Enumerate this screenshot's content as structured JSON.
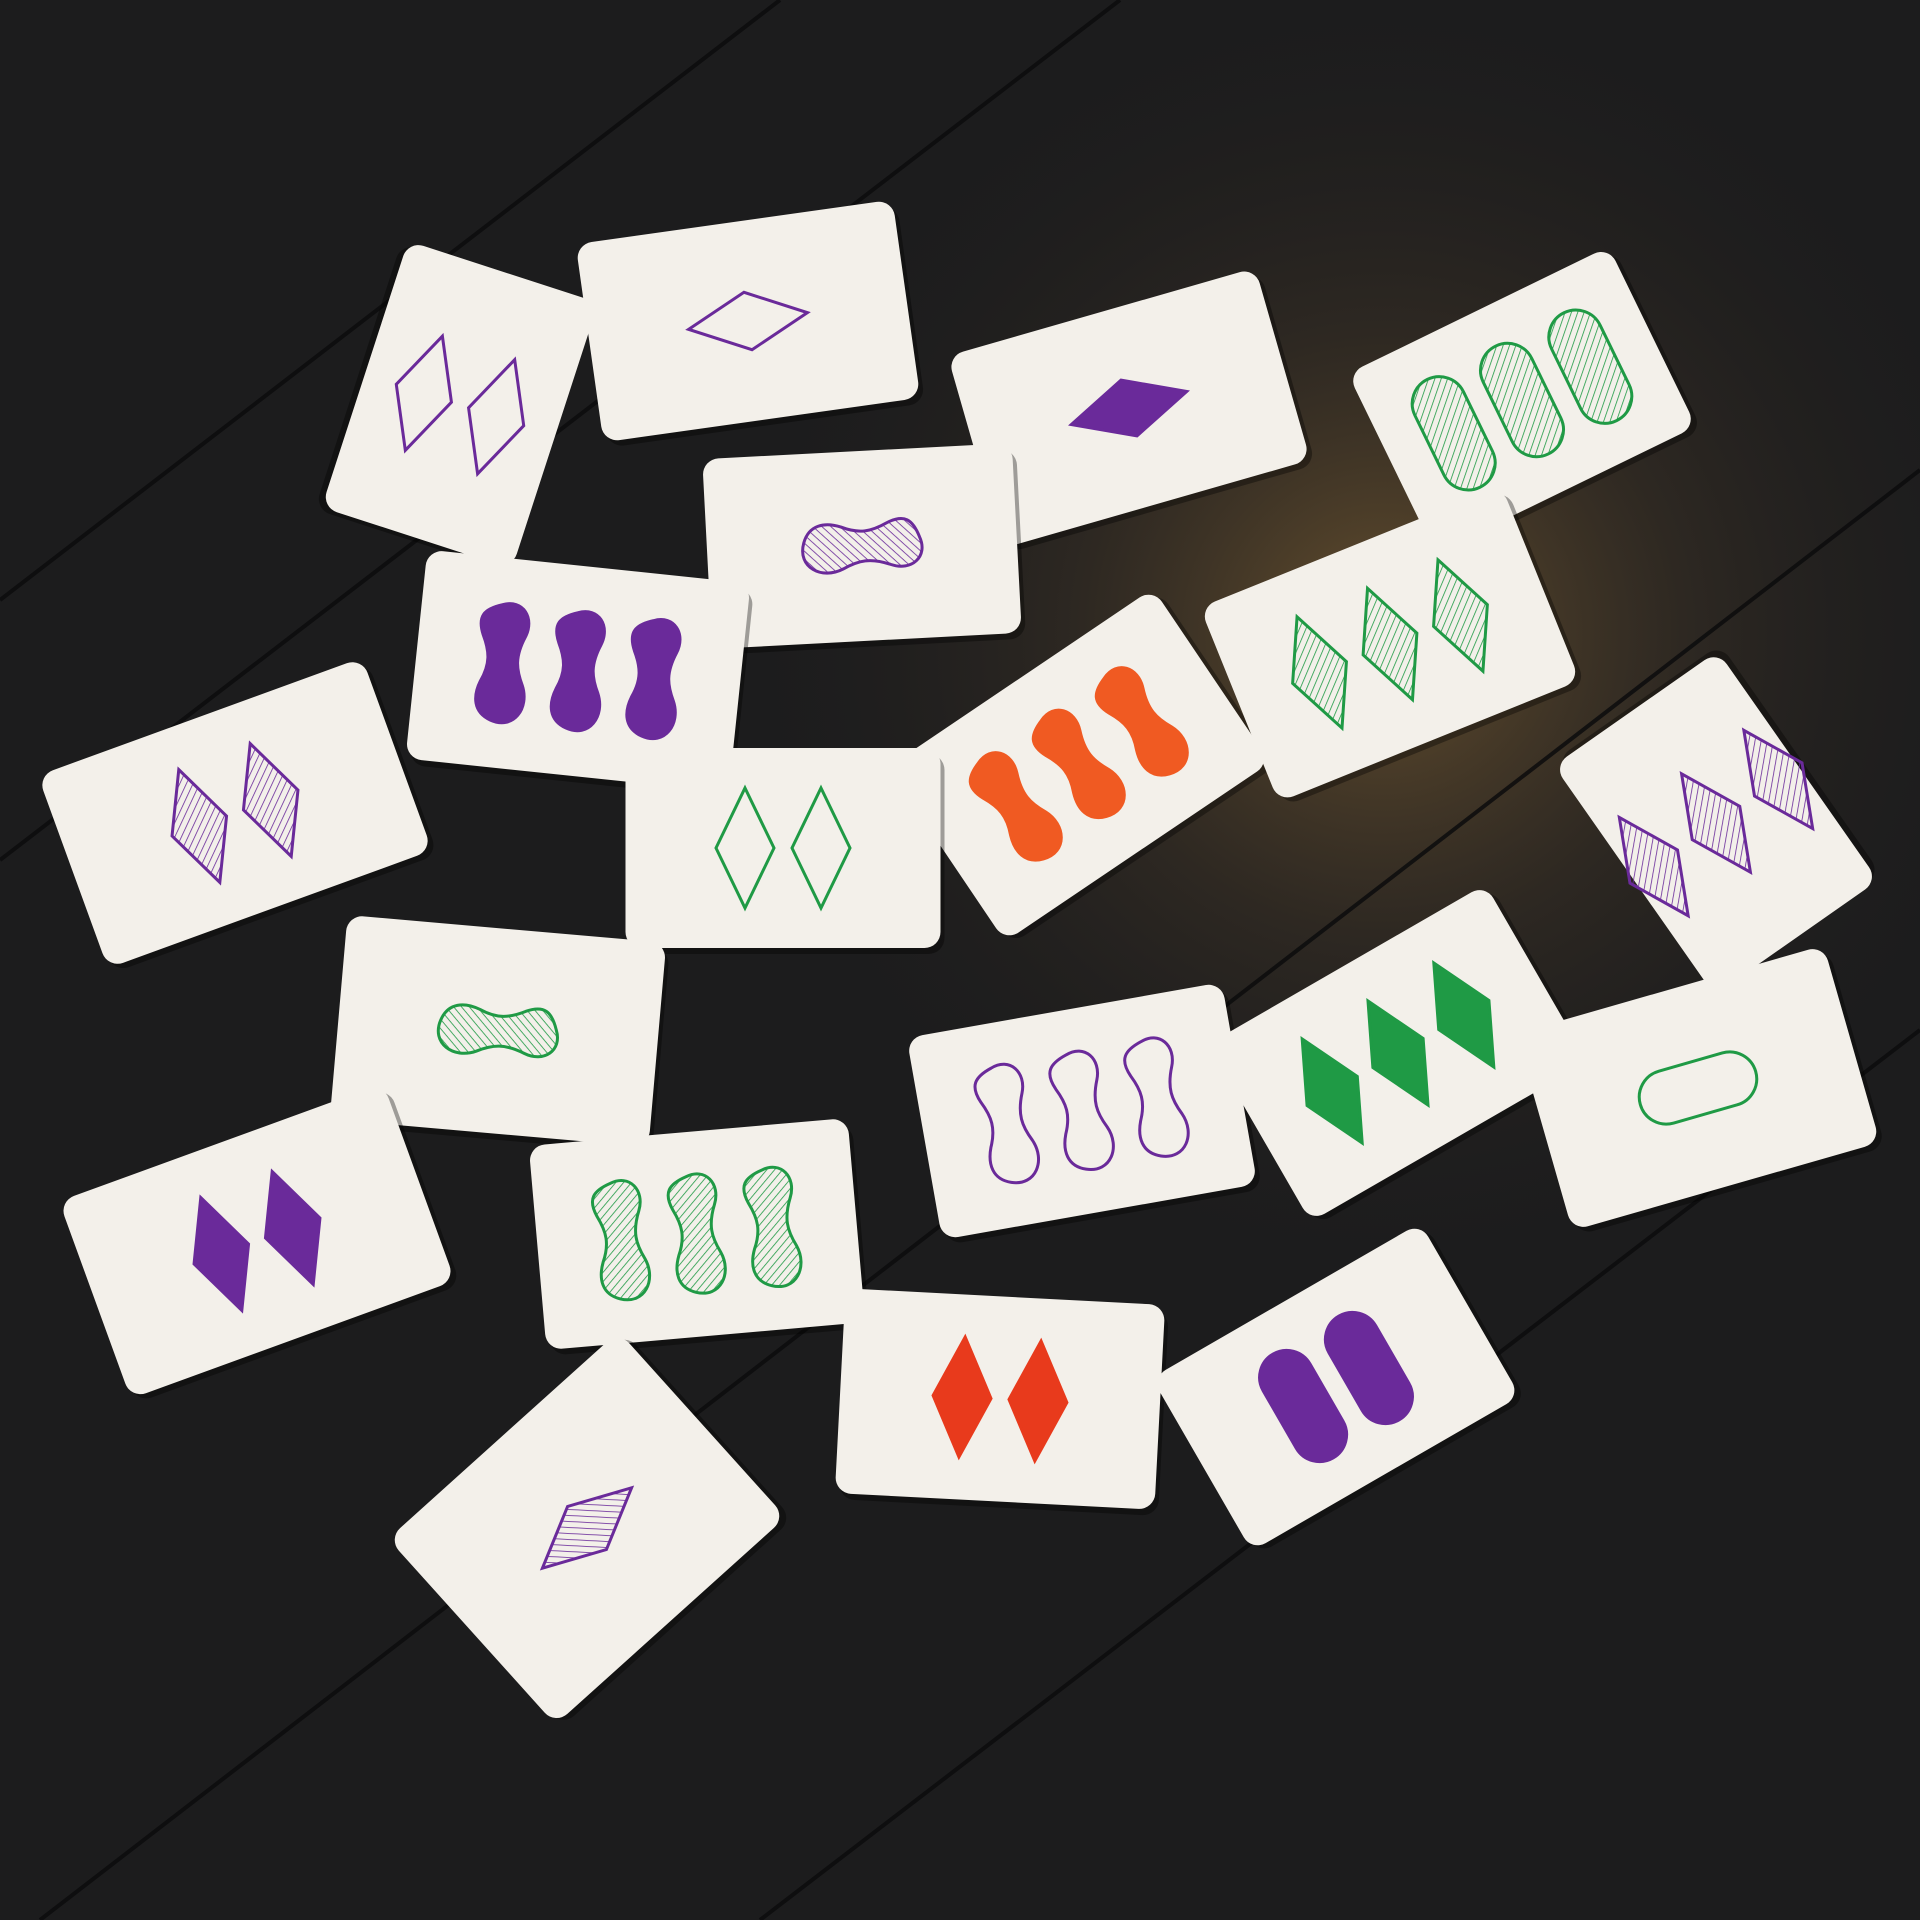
{
  "scene": {
    "kind": "set-card-game-layout",
    "card_count": 20
  },
  "colors": {
    "purple": "#6a2a9a",
    "green": "#1f9a45",
    "red": "#e83a1c",
    "orange": "#f05a22",
    "card": "#f3f0ea",
    "table": "#1c1c1d",
    "highlight": "#6a5330"
  },
  "cards": [
    {
      "count": 2,
      "shape": "diamond",
      "color": "purple",
      "fill": "outline"
    },
    {
      "count": 1,
      "shape": "diamond",
      "color": "purple",
      "fill": "outline"
    },
    {
      "count": 1,
      "shape": "diamond",
      "color": "purple",
      "fill": "solid"
    },
    {
      "count": 3,
      "shape": "oval",
      "color": "green",
      "fill": "striped"
    },
    {
      "count": 1,
      "shape": "squiggle",
      "color": "purple",
      "fill": "striped"
    },
    {
      "count": 3,
      "shape": "squiggle",
      "color": "purple",
      "fill": "solid"
    },
    {
      "count": 3,
      "shape": "squiggle",
      "color": "orange",
      "fill": "solid"
    },
    {
      "count": 3,
      "shape": "diamond",
      "color": "green",
      "fill": "striped"
    },
    {
      "count": 2,
      "shape": "diamond",
      "color": "purple",
      "fill": "striped"
    },
    {
      "count": 2,
      "shape": "diamond",
      "color": "green",
      "fill": "outline"
    },
    {
      "count": 3,
      "shape": "diamond",
      "color": "purple",
      "fill": "striped"
    },
    {
      "count": 1,
      "shape": "squiggle",
      "color": "green",
      "fill": "striped"
    },
    {
      "count": 3,
      "shape": "squiggle",
      "color": "purple",
      "fill": "outline"
    },
    {
      "count": 3,
      "shape": "diamond",
      "color": "green",
      "fill": "solid"
    },
    {
      "count": 1,
      "shape": "oval",
      "color": "green",
      "fill": "outline"
    },
    {
      "count": 2,
      "shape": "diamond",
      "color": "purple",
      "fill": "solid"
    },
    {
      "count": 3,
      "shape": "squiggle",
      "color": "green",
      "fill": "striped"
    },
    {
      "count": 2,
      "shape": "diamond",
      "color": "red",
      "fill": "solid"
    },
    {
      "count": 2,
      "shape": "oval",
      "color": "purple",
      "fill": "solid"
    },
    {
      "count": 1,
      "shape": "diamond",
      "color": "purple",
      "fill": "striped"
    }
  ]
}
